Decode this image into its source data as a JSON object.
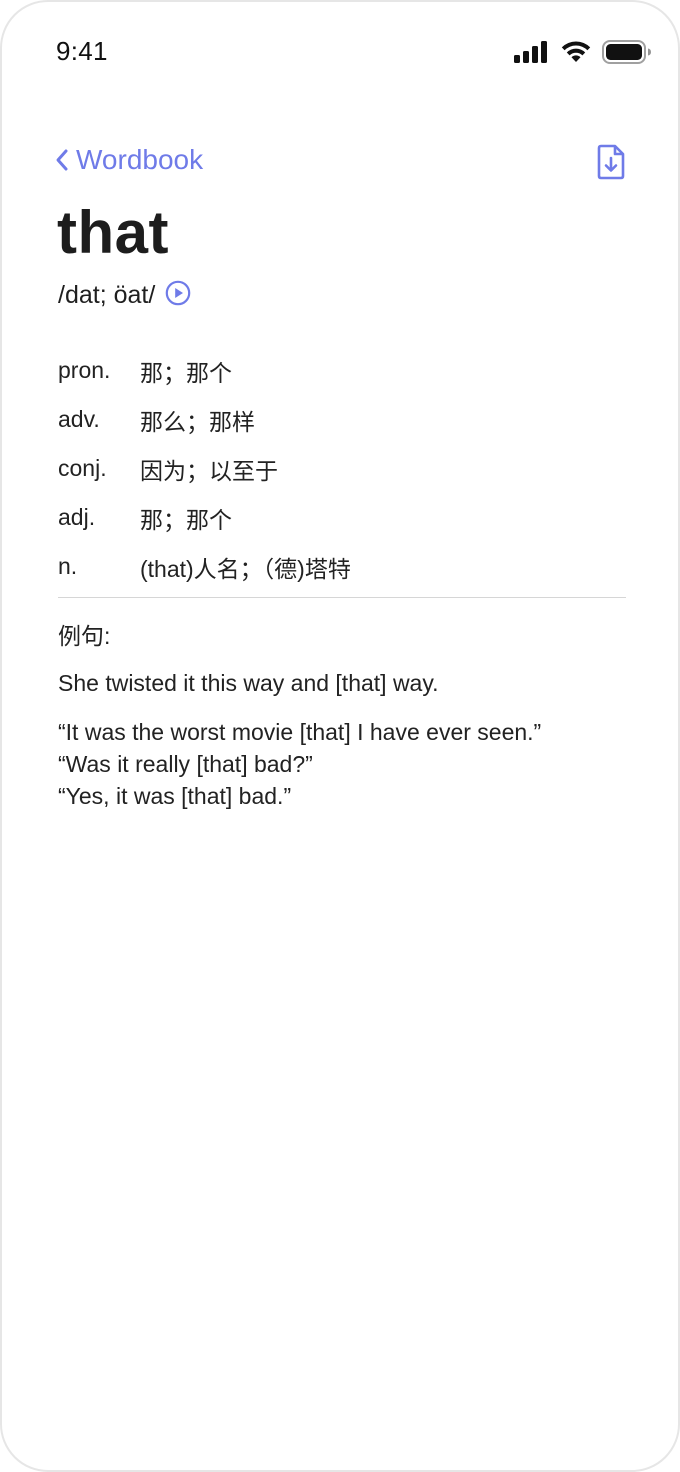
{
  "status_bar": {
    "time": "9:41"
  },
  "nav": {
    "back_label": "Wordbook",
    "back_icon": "chevron-left-icon",
    "action_icon": "download-document-icon",
    "accent_color": "#6f7be8"
  },
  "entry": {
    "word": "that",
    "phonetic": "/dat; öat/",
    "audio_icon": "play-circle-icon",
    "definitions": [
      {
        "pos": "pron.",
        "meaning": "那；那个"
      },
      {
        "pos": "adv.",
        "meaning": "那么；那样"
      },
      {
        "pos": "conj.",
        "meaning": "因为；以至于"
      },
      {
        "pos": "adj.",
        "meaning": "那；那个"
      },
      {
        "pos": "n.",
        "meaning": "(that)人名；（德)塔特"
      }
    ]
  },
  "examples": {
    "heading": "例句:",
    "items": [
      {
        "lines": [
          "She twisted it this way and [that] way."
        ]
      },
      {
        "lines": [
          "“It was the worst movie [that] I have ever seen.”",
          "“Was it really [that] bad?”",
          "“Yes, it was [that] bad.”"
        ]
      }
    ]
  }
}
